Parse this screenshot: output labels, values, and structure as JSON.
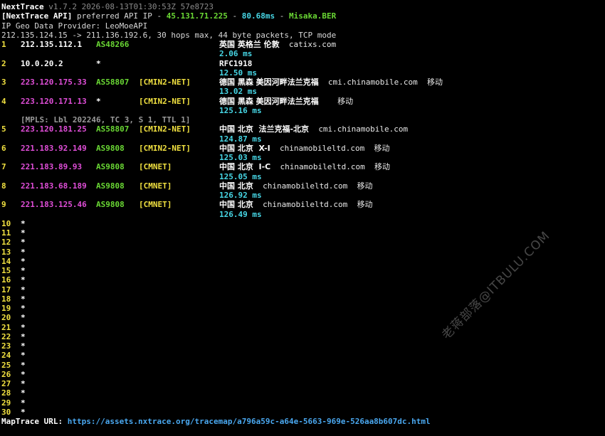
{
  "header": {
    "app_name": "NextTrace",
    "version_info": "v1.7.2 2026-08-13T01:30:53Z 57e8723",
    "api_label": "[NextTrace API]",
    "api_text": " preferred API IP - ",
    "api_ip": "45.131.71.225",
    "api_sep1": " - ",
    "api_latency": "80.68ms",
    "api_sep2": " - ",
    "api_location": "Misaka.BER",
    "geo_provider": "IP Geo Data Provider: LeoMoeAPI",
    "trace_summary": "212.135.124.15 -> 211.136.192.6, 30 hops max, 44 byte packets, TCP mode"
  },
  "hops": [
    {
      "num": "1",
      "ip": "212.135.112.1",
      "asn": "AS48266",
      "tag": "",
      "geo": "英国 英格兰 伦敦",
      "host": "catixs.com",
      "isp": "",
      "rtt": "2.06 ms",
      "ip_color": "white"
    },
    {
      "num": "2",
      "ip": "10.0.20.2",
      "asn": "*",
      "tag": "",
      "geo": "",
      "host": "RFC1918",
      "isp": "",
      "rtt": "12.50 ms",
      "ip_color": "white"
    },
    {
      "num": "3",
      "ip": "223.120.175.33",
      "asn": "AS58807",
      "tag": "[CMIN2-NET]",
      "geo": "德国 黑森 美因河畔法兰克福",
      "host": "cmi.chinamobile.com",
      "isp": "移动",
      "rtt": "13.02 ms",
      "ip_color": "magenta"
    },
    {
      "num": "4",
      "ip": "223.120.171.13",
      "asn": "*",
      "tag": "[CMIN2-NET]",
      "geo": "德国 黑森 美因河畔法兰克福",
      "host": "",
      "isp": "移动",
      "rtt": "125.16 ms",
      "ip_color": "magenta"
    },
    {
      "num": "5",
      "ip": "223.120.181.25",
      "asn": "AS58807",
      "tag": "[CMIN2-NET]",
      "geo": "中国 北京  法兰克福-北京",
      "host": "cmi.chinamobile.com",
      "isp": "",
      "rtt": "124.87 ms",
      "ip_color": "magenta",
      "mpls": "[MPLS: Lbl 202246, TC 3, S 1, TTL 1]"
    },
    {
      "num": "6",
      "ip": "221.183.92.149",
      "asn": "AS9808",
      "tag": "[CMIN2-NET]",
      "geo": "中国 北京  X-I",
      "host": "chinamobileltd.com",
      "isp": "移动",
      "rtt": "125.03 ms",
      "ip_color": "magenta"
    },
    {
      "num": "7",
      "ip": "221.183.89.93",
      "asn": "AS9808",
      "tag": "[CMNET]",
      "geo": "中国 北京  I-C",
      "host": "chinamobileltd.com",
      "isp": "移动",
      "rtt": "125.05 ms",
      "ip_color": "magenta"
    },
    {
      "num": "8",
      "ip": "221.183.68.189",
      "asn": "AS9808",
      "tag": "[CMNET]",
      "geo": "中国 北京",
      "host": "chinamobileltd.com",
      "isp": "移动",
      "rtt": "126.92 ms",
      "ip_color": "magenta"
    },
    {
      "num": "9",
      "ip": "221.183.125.46",
      "asn": "AS9808",
      "tag": "[CMNET]",
      "geo": "中国 北京",
      "host": "chinamobileltd.com",
      "isp": "移动",
      "rtt": "126.49 ms",
      "ip_color": "magenta"
    }
  ],
  "timeout_hops": [
    "10",
    "11",
    "12",
    "13",
    "14",
    "15",
    "16",
    "17",
    "18",
    "19",
    "20",
    "21",
    "22",
    "23",
    "24",
    "25",
    "26",
    "27",
    "28",
    "29",
    "30"
  ],
  "timeout_mark": "*",
  "footer": {
    "label": "MapTrace URL:",
    "url": "https://assets.nxtrace.org/tracemap/a796a59c-a64e-5663-969e-526aa8b607dc.html"
  },
  "watermark": "老蒋部落@ITBULU.COM",
  "colors": {
    "background": "#000000",
    "hop_number": "#f0e040",
    "ip_private": "#ffffff",
    "ip_carrier": "#e04ed8",
    "asn": "#6ad834",
    "tag": "#f0e040",
    "rtt": "#47d7e6",
    "url": "#4aa8f0"
  }
}
